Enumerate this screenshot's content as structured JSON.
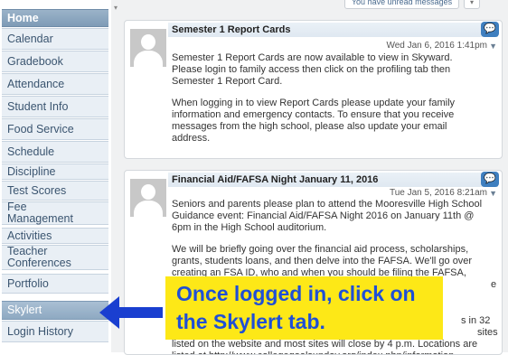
{
  "sidebar": {
    "items": [
      {
        "label": "Home"
      },
      {
        "label": "Calendar"
      },
      {
        "label": "Gradebook"
      },
      {
        "label": "Attendance"
      },
      {
        "label": "Student Info"
      },
      {
        "label": "Food Service"
      },
      {
        "label": "Schedule"
      },
      {
        "label": "Discipline"
      },
      {
        "label": "Test Scores"
      },
      {
        "label": "Fee Management"
      },
      {
        "label": "Activities"
      },
      {
        "label": "Teacher Conferences"
      },
      {
        "label": "Portfolio"
      },
      {
        "label": "Skylert"
      },
      {
        "label": "Login History"
      }
    ],
    "selected": "Skylert"
  },
  "top": {
    "messages_button": "You have unread messages"
  },
  "messages": [
    {
      "title": "Semester 1 Report Cards",
      "date": "Wed Jan 6, 2016 1:41pm",
      "paragraphs": [
        "Semester 1 Report Cards are now available to view in Skyward.  Please login to family access then click on the profiling tab then Semester 1 Report Card.",
        "When logging in to view Report Cards please update your family information and emergency contacts.  To ensure that you receive messages from the high school, please also update your email address."
      ]
    },
    {
      "title": "Financial Aid/FAFSA Night January 11, 2016",
      "date": "Tue Jan 5, 2016 8:21am",
      "paragraphs": [
        "Seniors and parents please plan to attend the Mooresville High School Guidance event: Financial Aid/FAFSA Night 2016 on January 11th @ 6pm in the High School auditorium.",
        "We will be briefly going over the financial aid process, scholarships, grants, students loans, and then delve into the FAFSA.  We'll go over creating an FSA ID, who and when you should be filing the FAFSA, common mistakes, as well",
        "listed on the website and most sites will close by 4 p.m. Locations are listed at http://www.collegegoalsunday.org/index.php/information"
      ],
      "partial_right_1": "e",
      "partial_right_2": "s in 32",
      "partial_right_3": "sites"
    }
  ],
  "overlay": {
    "callout_line1": "Once logged in, click on",
    "callout_line2": "the Skylert tab.",
    "callout_color": "#fde817",
    "text_color": "#1f4fd6",
    "arrow_color": "#1a3fd0"
  }
}
